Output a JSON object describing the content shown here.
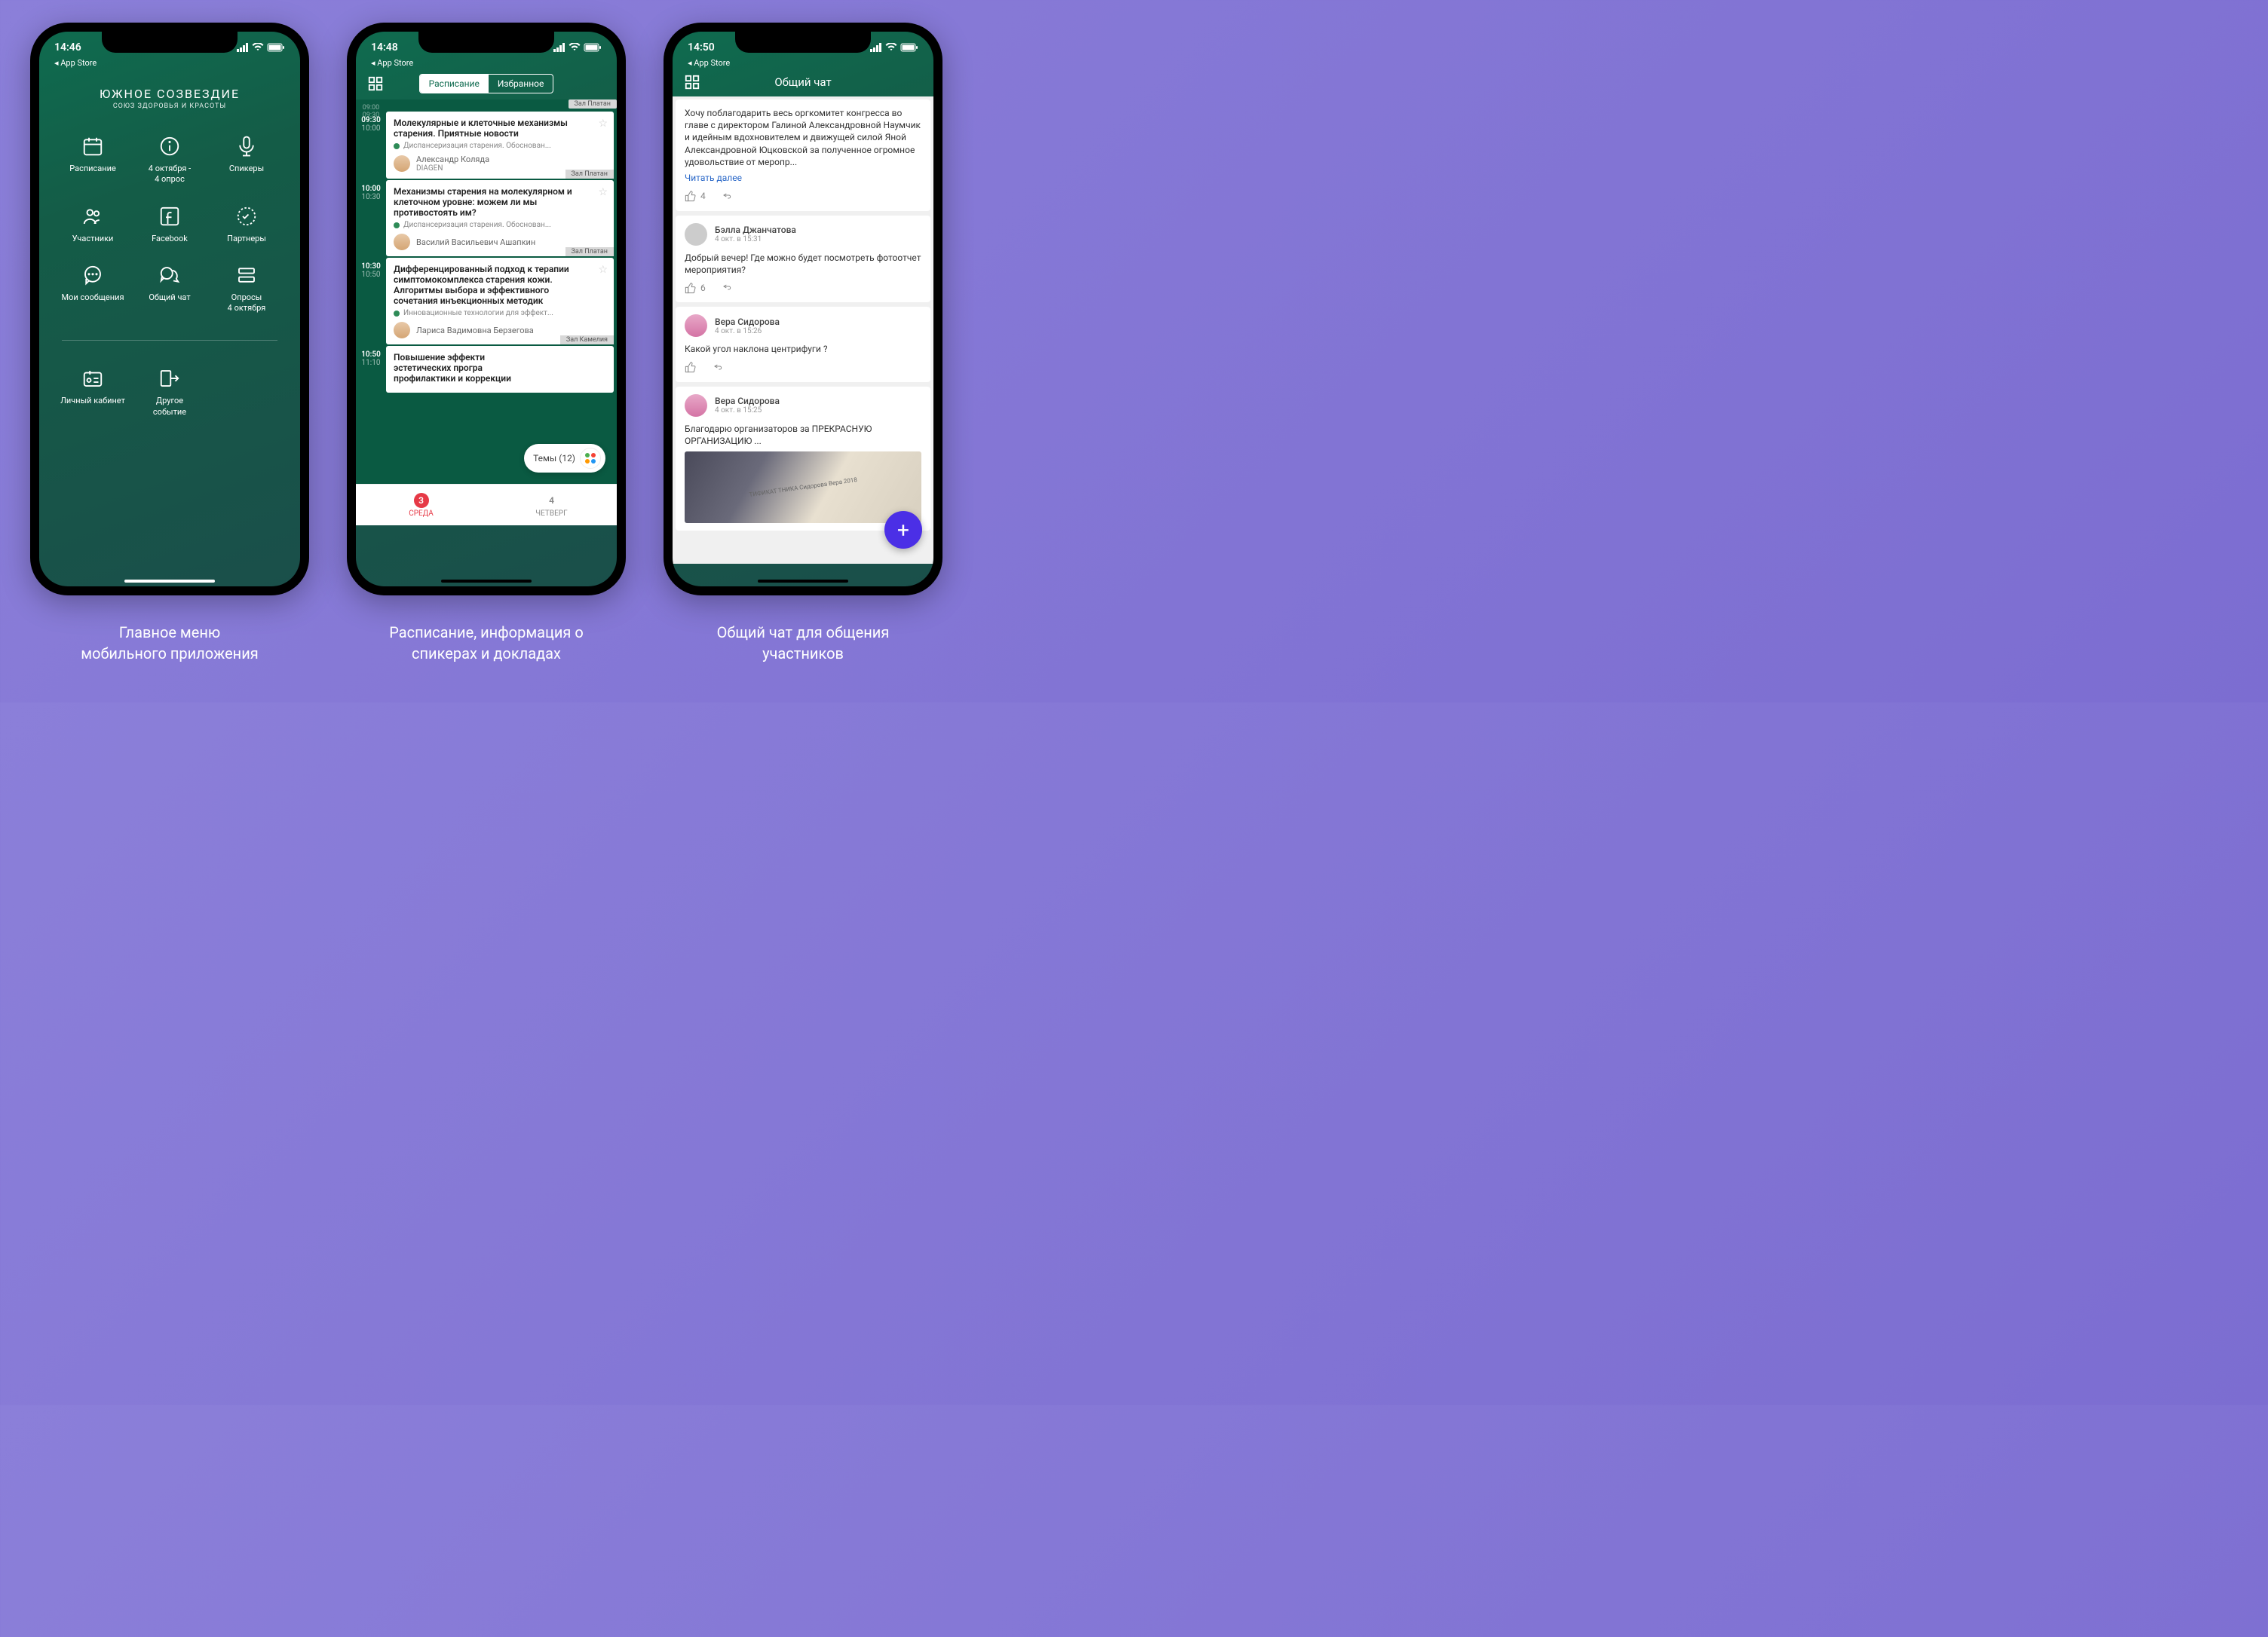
{
  "background": "#8b7fd9",
  "captions": [
    "Главное меню\nмобильного приложения",
    "Расписание, информация о\nспикерах и докладах",
    "Общий чат для общения\nучастников"
  ],
  "phone1": {
    "status_time": "14:46",
    "app_back": "◂ App Store",
    "title": "ЮЖНОЕ СОЗВЕЗДИЕ",
    "subtitle": "СОЮЗ ЗДОРОВЬЯ И КРАСОТЫ",
    "menu": [
      {
        "label": "Расписание",
        "icon": "calendar"
      },
      {
        "label": "4 октября -\n4 опрос",
        "icon": "info"
      },
      {
        "label": "Спикеры",
        "icon": "mic"
      },
      {
        "label": "Участники",
        "icon": "people"
      },
      {
        "label": "Facebook",
        "icon": "facebook"
      },
      {
        "label": "Партнеры",
        "icon": "badge"
      },
      {
        "label": "Мои сообщения",
        "icon": "chat"
      },
      {
        "label": "Общий чат",
        "icon": "group-chat"
      },
      {
        "label": "Опросы\n4 октября",
        "icon": "survey"
      }
    ],
    "menu_bottom": [
      {
        "label": "Личный кабинет",
        "icon": "account"
      },
      {
        "label": "Другое\nсобытие",
        "icon": "exit"
      }
    ]
  },
  "phone2": {
    "status_time": "14:48",
    "app_back": "◂ App Store",
    "tabs": {
      "schedule": "Расписание",
      "favorites": "Избранное"
    },
    "prev_time": "09:00\n09:30",
    "events": [
      {
        "start": "09:30",
        "end": "10:00",
        "room": "Зал Платан",
        "title": "Молекулярные и клеточные механизмы старения. Приятные новости",
        "track": "Диспансеризация старения. Обоснован...",
        "speaker": "Александр Коляда",
        "company": "DIAGEN",
        "room_bottom": "Зал Платан"
      },
      {
        "start": "10:00",
        "end": "10:30",
        "title": "Механизмы старения на молекулярном и клеточном уровне: можем ли мы противостоять им?",
        "track": "Диспансеризация старения. Обоснован...",
        "speaker": "Василий Васильевич Ашапкин",
        "room_bottom": "Зал Платан"
      },
      {
        "start": "10:30",
        "end": "10:50",
        "title": "Дифференцированный подход к терапии симптомокомплекса старения кожи. Алгоритмы выбора и эффективного сочетания инъекционных методик",
        "track": "Инновационные технологии для эффект...",
        "speaker": "Лариса Вадимовна Берзегова",
        "room_bottom": "Зал Камелия"
      },
      {
        "start": "10:50",
        "end": "11:10",
        "title": "Повышение эффекти\nэстетических програ\nпрофилактики и коррекции"
      }
    ],
    "themes_label": "Темы (12)",
    "days": [
      {
        "num": "3",
        "label": "СРЕДА",
        "active": true
      },
      {
        "num": "4",
        "label": "ЧЕТВЕРГ",
        "active": false
      }
    ]
  },
  "phone3": {
    "status_time": "14:50",
    "app_back": "◂ App Store",
    "title": "Общий чат",
    "posts": [
      {
        "text": "Хочу поблагодарить весь оргкомитет конгресса во главе с директором Галиной Александровной Наумчик и идейным вдохновителем и движущей силой Яной Александровной Юцковской за полученное огромное удовольствие от меропр...",
        "read_more": "Читать далее",
        "likes": "4"
      },
      {
        "author": "Бэлла Джанчатова",
        "time": "4 окт. в 15:31",
        "text": "Добрый вечер! Где можно будет посмотреть фотоотчет мероприятия?",
        "likes": "6"
      },
      {
        "author": "Вера Сидорова",
        "time": "4 окт. в 15:26",
        "text": "Какой угол наклона центрифуги ?"
      },
      {
        "author": "Вера Сидорова",
        "time": "4 окт. в 15:25",
        "text": "Благодарю организаторов за ПРЕКРАСНУЮ ОРГАНИЗАЦИЮ ...",
        "has_image": true,
        "image_text": "ТИФИКАТ\nТНИКА  Сидорова Вера 2018"
      }
    ],
    "fab": "+"
  }
}
